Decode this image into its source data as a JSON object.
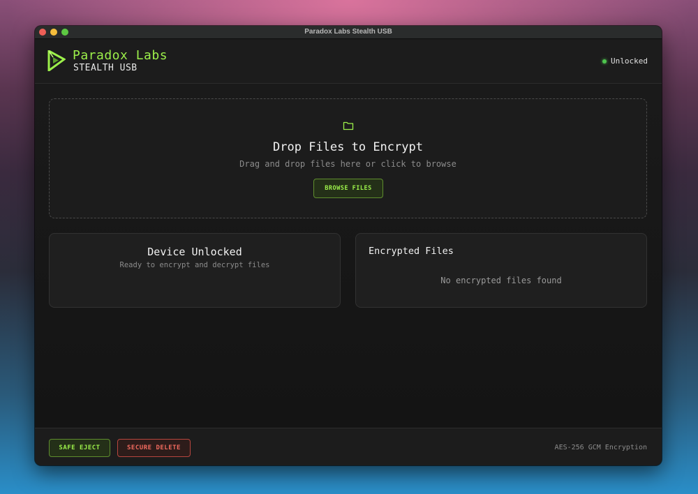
{
  "window": {
    "title": "Paradox Labs Stealth USB"
  },
  "header": {
    "brand_name": "Paradox Labs",
    "brand_sub": "STEALTH USB",
    "status_label": "Unlocked",
    "status_color": "#4ec54e"
  },
  "dropzone": {
    "icon": "folder-icon",
    "title": "Drop Files to Encrypt",
    "subtitle": "Drag and drop files here or click to browse",
    "button_label": "BROWSE FILES"
  },
  "device_card": {
    "title": "Device Unlocked",
    "subtitle": "Ready to encrypt and decrypt files"
  },
  "files_card": {
    "title": "Encrypted Files",
    "empty_text": "No encrypted files found"
  },
  "footer": {
    "eject_label": "SAFE EJECT",
    "delete_label": "SECURE DELETE",
    "encryption_label": "AES-256 GCM Encryption"
  },
  "colors": {
    "accent": "#9cf04a",
    "danger": "#f06a5e",
    "background": "#181818"
  }
}
